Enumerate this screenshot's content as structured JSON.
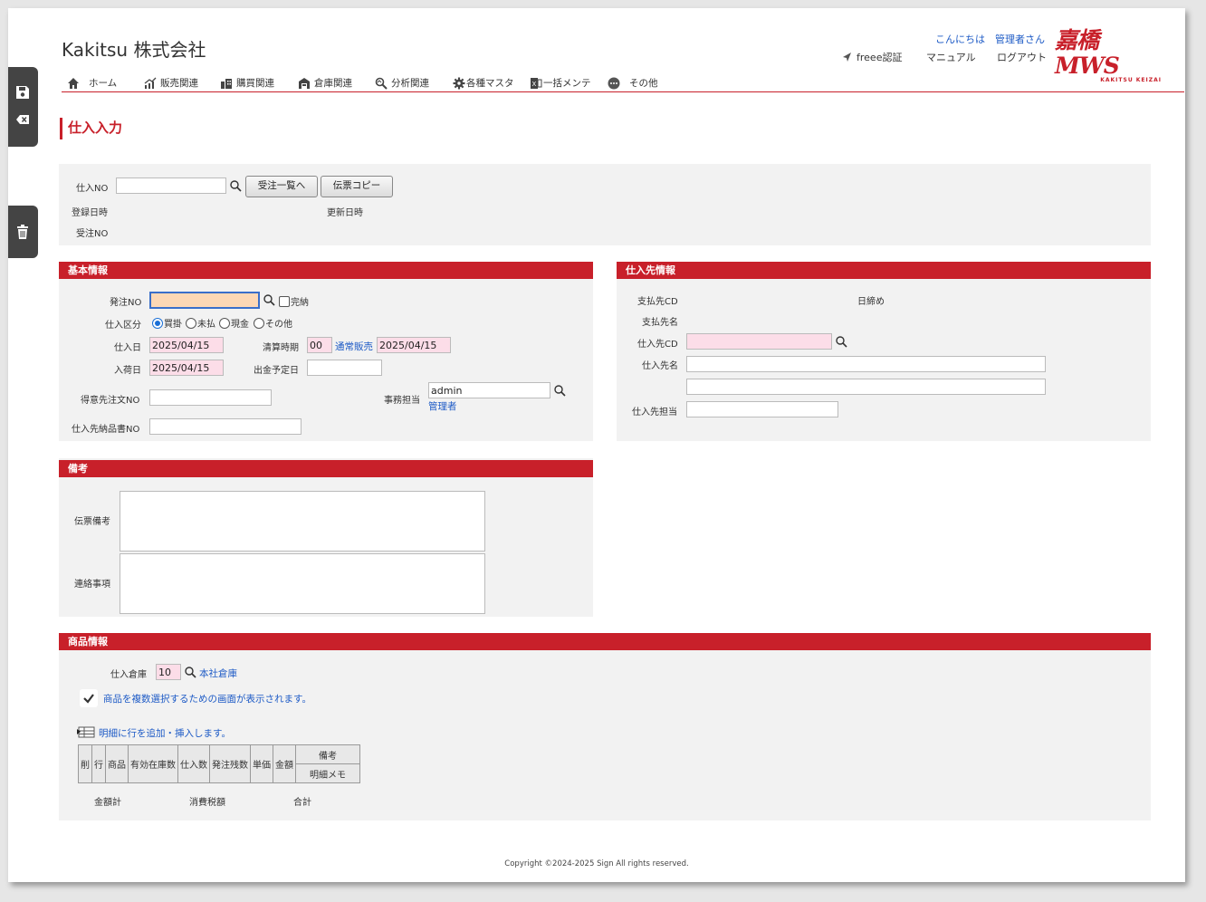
{
  "header": {
    "company": "Kakitsu 株式会社",
    "greeting": "こんにちは",
    "user": "管理者さん",
    "freee": "freee認証",
    "manual": "マニュアル",
    "logout": "ログアウト",
    "logo_main": "嘉橋MWS",
    "logo_sub": "KAKITSU KEIZAI"
  },
  "nav": [
    {
      "label": "ホーム",
      "icon": "home-icon"
    },
    {
      "label": "販売関連",
      "icon": "chart-icon"
    },
    {
      "label": "購買関連",
      "icon": "building-icon"
    },
    {
      "label": "倉庫関連",
      "icon": "warehouse-icon"
    },
    {
      "label": "分析関連",
      "icon": "analysis-icon"
    },
    {
      "label": "各種マスタ",
      "icon": "gear-icon"
    },
    {
      "label": "一括メンテ",
      "icon": "excel-icon"
    },
    {
      "label": "その他",
      "icon": "more-icon"
    }
  ],
  "sidebar": {
    "save_icon": "save-icon",
    "clear_icon": "clear-icon",
    "delete_icon": "trash-icon"
  },
  "page_title": "仕入入力",
  "top": {
    "shiire_no_label": "仕入NO",
    "shiire_no_value": "",
    "btn_order_list": "受注一覧へ",
    "btn_copy": "伝票コピー",
    "created_label": "登録日時",
    "updated_label": "更新日時",
    "order_no_label": "受注NO"
  },
  "basic": {
    "title": "基本情報",
    "po_label": "発注NO",
    "po_value": "",
    "complete_label": "完納",
    "type_label": "仕入区分",
    "types": [
      "買掛",
      "未払",
      "現金",
      "その他"
    ],
    "type_selected": "買掛",
    "date_label": "仕入日",
    "date_value": "2025/04/15",
    "settle_label": "清算時期",
    "settle_code": "00",
    "settle_name": "通常販売",
    "settle_date": "2025/04/15",
    "arrival_label": "入荷日",
    "arrival_value": "2025/04/15",
    "pay_plan_label": "出金予定日",
    "pay_plan_value": "",
    "cust_order_label": "得意先注文NO",
    "cust_order_value": "",
    "staff_label": "事務担当",
    "staff_value": "admin",
    "staff_name": "管理者",
    "delivery_no_label": "仕入先納品書NO",
    "delivery_no_value": ""
  },
  "supplier": {
    "title": "仕入先情報",
    "pay_cd_label": "支払先CD",
    "closing_label": "日締め",
    "pay_name_label": "支払先名",
    "cd_label": "仕入先CD",
    "cd_value": "",
    "name_label": "仕入先名",
    "name_value": "",
    "name2_value": "",
    "staff_label": "仕入先担当",
    "staff_value": ""
  },
  "remarks": {
    "title": "備考",
    "slip_label": "伝票備考",
    "contact_label": "連絡事項"
  },
  "products": {
    "title": "商品情報",
    "warehouse_label": "仕入倉庫",
    "warehouse_code": "10",
    "warehouse_name": "本社倉庫",
    "multi_select_text": "商品を複数選択するための画面が表示されます。",
    "add_row_text": "明細に行を追加・挿入します。",
    "columns": [
      "削",
      "行",
      "商品",
      "有効在庫数",
      "仕入数",
      "発注残数",
      "単価",
      "金額"
    ],
    "col_remarks": "備考",
    "col_memo": "明細メモ",
    "total_label": "金額計",
    "tax_label": "消費税額",
    "grand_label": "合計"
  },
  "footer": {
    "copyright": "Copyright ©2024-2025 Sign All rights reserved."
  },
  "colors": {
    "accent": "#c8202a",
    "link": "#1e5bc6",
    "panel": "#f2f2f2"
  }
}
